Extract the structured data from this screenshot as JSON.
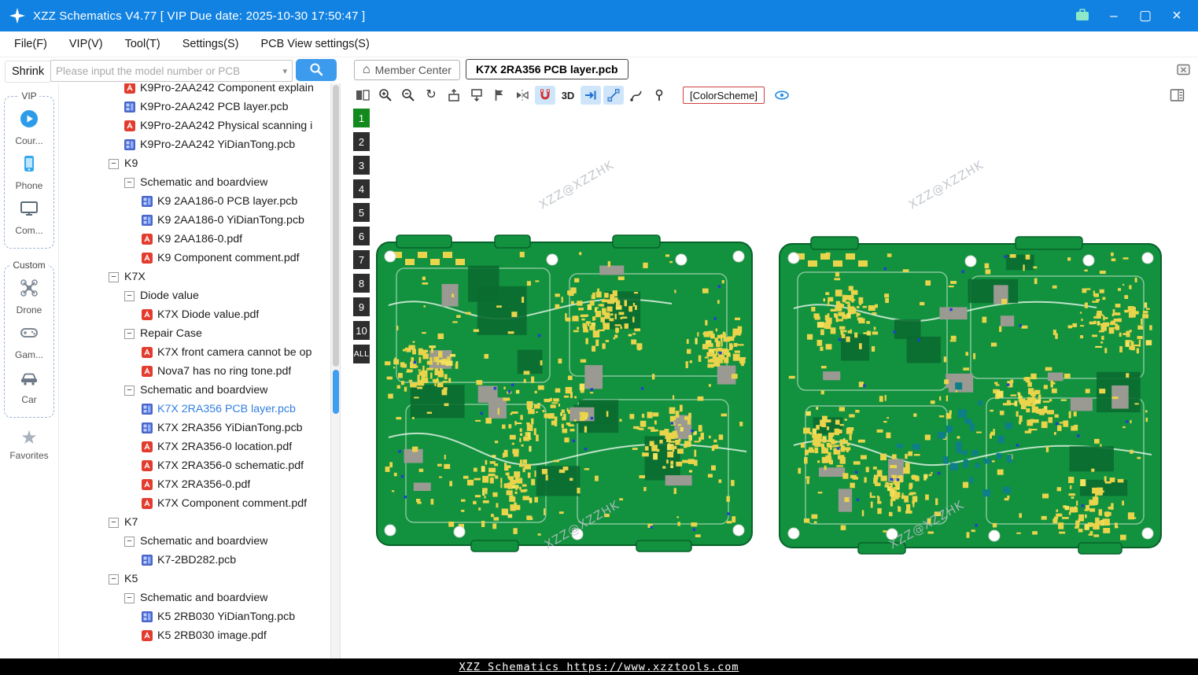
{
  "window": {
    "title": "XZZ Schematics V4.77 [ VIP Due date: 2025-10-30 17:50:47 ]"
  },
  "icons": {
    "collapse": "−",
    "caret_down": "▾",
    "home": "⌂",
    "rotate": "↻",
    "window_min": "–",
    "window_max": "▢",
    "window_close": "×",
    "star": "★"
  },
  "menubar": {
    "items": [
      "File(F)",
      "VIP(V)",
      "Tool(T)",
      "Settings(S)",
      "PCB View settings(S)"
    ]
  },
  "toolbar": {
    "shrink_label": "Shrink",
    "search_placeholder": "Please input the model number or PCB",
    "member_center_label": "Member Center",
    "active_tab": "K7X 2RA356 PCB layer.pcb"
  },
  "sidebar": {
    "groups": [
      {
        "label": "VIP",
        "items": [
          {
            "label": "Cour...",
            "icon": "play-circle"
          },
          {
            "label": "Phone",
            "icon": "phone"
          },
          {
            "label": "Com...",
            "icon": "computer"
          }
        ]
      },
      {
        "label": "Custom",
        "items": [
          {
            "label": "Drone",
            "icon": "drone"
          },
          {
            "label": "Gam...",
            "icon": "gamepad"
          },
          {
            "label": "Car",
            "icon": "car"
          }
        ]
      }
    ],
    "favorites_label": "Favorites"
  },
  "tree": {
    "items": [
      {
        "label": "K9Pro-2AA242 Component explain",
        "type": "pdf",
        "level": 2
      },
      {
        "label": "K9Pro-2AA242 PCB layer.pcb",
        "type": "pcb",
        "level": 2
      },
      {
        "label": "K9Pro-2AA242 Physical scanning i",
        "type": "pdf",
        "level": 2
      },
      {
        "label": "K9Pro-2AA242 YiDianTong.pcb",
        "type": "pcb",
        "level": 2
      },
      {
        "label": "K9",
        "type": "folder",
        "level": 1
      },
      {
        "label": "Schematic and boardview",
        "type": "folder",
        "level": 2
      },
      {
        "label": "K9 2AA186-0 PCB layer.pcb",
        "type": "pcb",
        "level": 3
      },
      {
        "label": "K9 2AA186-0 YiDianTong.pcb",
        "type": "pcb",
        "level": 3
      },
      {
        "label": "K9 2AA186-0.pdf",
        "type": "pdf",
        "level": 3
      },
      {
        "label": "K9 Component comment.pdf",
        "type": "pdf",
        "level": 3
      },
      {
        "label": "K7X",
        "type": "folder",
        "level": 1
      },
      {
        "label": "Diode value",
        "type": "folder",
        "level": 2
      },
      {
        "label": "K7X Diode value.pdf",
        "type": "pdf",
        "level": 3
      },
      {
        "label": "Repair Case",
        "type": "folder",
        "level": 2
      },
      {
        "label": "K7X front camera cannot be op",
        "type": "pdf",
        "level": 3
      },
      {
        "label": "Nova7 has no ring tone.pdf",
        "type": "pdf",
        "level": 3
      },
      {
        "label": "Schematic and boardview",
        "type": "folder",
        "level": 2
      },
      {
        "label": "K7X 2RA356 PCB layer.pcb",
        "type": "pcb",
        "level": 3,
        "selected": true
      },
      {
        "label": "K7X 2RA356 YiDianTong.pcb",
        "type": "pcb",
        "level": 3
      },
      {
        "label": "K7X 2RA356-0 location.pdf",
        "type": "pdf",
        "level": 3
      },
      {
        "label": "K7X 2RA356-0 schematic.pdf",
        "type": "pdf",
        "level": 3
      },
      {
        "label": "K7X 2RA356-0.pdf",
        "type": "pdf",
        "level": 3
      },
      {
        "label": "K7X Component comment.pdf",
        "type": "pdf",
        "level": 3
      },
      {
        "label": "K7",
        "type": "folder",
        "level": 1
      },
      {
        "label": "Schematic and boardview",
        "type": "folder",
        "level": 2
      },
      {
        "label": "K7-2BD282.pcb",
        "type": "pcb",
        "level": 3
      },
      {
        "label": "K5",
        "type": "folder",
        "level": 1
      },
      {
        "label": "Schematic and boardview",
        "type": "folder",
        "level": 2
      },
      {
        "label": "K5 2RB030 YiDianTong.pcb",
        "type": "pcb",
        "level": 3
      },
      {
        "label": "K5 2RB030 image.pdf",
        "type": "pdf",
        "level": 3
      }
    ]
  },
  "viewer": {
    "labels": {
      "three_d": "3D",
      "color_scheme": "[ColorScheme]"
    },
    "layers": [
      "1",
      "2",
      "3",
      "4",
      "5",
      "6",
      "7",
      "8",
      "9",
      "10",
      "ALL"
    ],
    "active_layer": "1",
    "watermark": "XZZ@XZZHK"
  },
  "statusbar": {
    "text": "XZZ Schematics https://www.xzztools.com"
  },
  "colors": {
    "titlebar_bg": "#1182e2",
    "accent_blue": "#2b8fe8",
    "search_btn": "#3d9bee",
    "selected_text": "#2f7fe0",
    "board_green": "#12913f",
    "board_dark": "#0a6b30",
    "board_border": "#07632a",
    "pad_yellow": "#e9d44b",
    "pad_yellow2": "#f4e35e",
    "block_gray": "#9a9a92",
    "dot_blue": "#2240cc",
    "teal": "#0e7f86",
    "layer_active": "#128a1d",
    "layer_bg": "#2e2e2e",
    "status_bg": "#000000",
    "pdf_red": "#e23c2e",
    "pcb_icon_blue": "#4a66c8",
    "watermark_gray": "#b9c0c6"
  }
}
